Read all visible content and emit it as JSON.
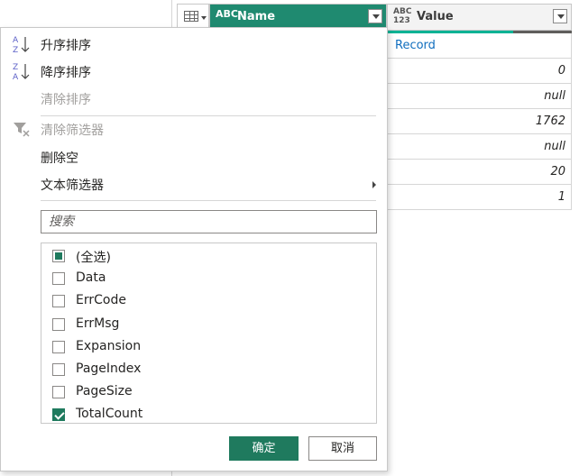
{
  "grid": {
    "name_header": "Name",
    "value_header": "Value",
    "name_type_icon": "ABC",
    "value_type_icon_top": "ABC",
    "value_type_icon_bottom": "123",
    "rows": [
      "Record",
      "0",
      "null",
      "1762",
      "null",
      "20",
      "1"
    ]
  },
  "menu": {
    "sort_asc": "升序排序",
    "sort_desc": "降序排序",
    "clear_sort": "清除排序",
    "clear_filter": "清除筛选器",
    "remove_empty": "删除空",
    "text_filters": "文本筛选器"
  },
  "search": {
    "placeholder": "搜索"
  },
  "checklist": [
    {
      "label": "(全选)",
      "state": "partial"
    },
    {
      "label": "Data",
      "state": "unchecked"
    },
    {
      "label": "ErrCode",
      "state": "unchecked"
    },
    {
      "label": "ErrMsg",
      "state": "unchecked"
    },
    {
      "label": "Expansion",
      "state": "unchecked"
    },
    {
      "label": "PageIndex",
      "state": "unchecked"
    },
    {
      "label": "PageSize",
      "state": "unchecked"
    },
    {
      "label": "TotalCount",
      "state": "checked"
    }
  ],
  "buttons": {
    "ok": "确定",
    "cancel": "取消"
  },
  "colors": {
    "accent": "#1f7a5e",
    "header_selected": "#1f8a70",
    "quality_ok": "#00b294"
  }
}
